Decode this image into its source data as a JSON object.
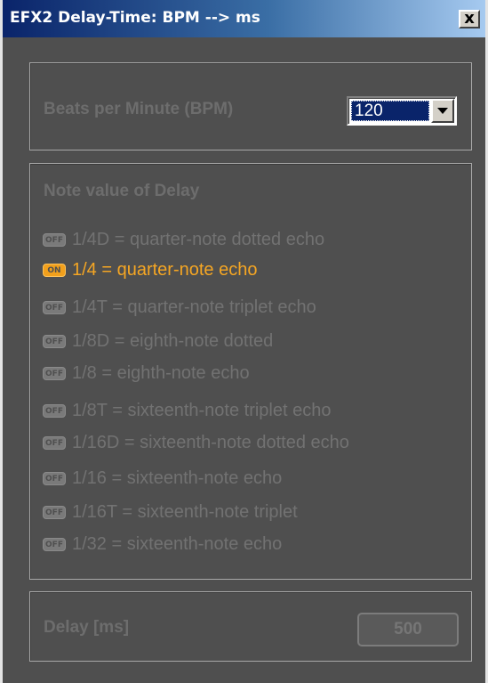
{
  "window": {
    "title": "EFX2 Delay-Time: BPM --> ms",
    "close_label": "x"
  },
  "bpm": {
    "label": "Beats per Minute (BPM)",
    "selected_value": "120"
  },
  "notes": {
    "title": "Note value of Delay",
    "items": [
      {
        "state": "OFF",
        "label": "1/4D =  quarter-note dotted echo",
        "active": false
      },
      {
        "state": "ON",
        "label": "1/4 = quarter-note echo",
        "active": true
      },
      {
        "state": "OFF",
        "label": "1/4T = quarter-note triplet echo",
        "active": false
      },
      {
        "state": "OFF",
        "label": "1/8D = eighth-note dotted",
        "active": false
      },
      {
        "state": "OFF",
        "label": "1/8 = eighth-note echo",
        "active": false
      },
      {
        "state": "OFF",
        "label": "1/8T = sixteenth-note triplet echo",
        "active": false
      },
      {
        "state": "OFF",
        "label": "1/16D = sixteenth-note dotted echo",
        "active": false
      },
      {
        "state": "OFF",
        "label": "1/16 = sixteenth-note echo",
        "active": false
      },
      {
        "state": "OFF",
        "label": "1/16T = sixteenth-note triplet",
        "active": false
      },
      {
        "state": "OFF",
        "label": "1/32 = sixteenth-note echo",
        "active": false
      }
    ]
  },
  "delay": {
    "label": "Delay [ms]",
    "value": "500"
  },
  "colors": {
    "panel_bg": "#4f4f4f",
    "accent_on": "#f5a623",
    "dim_text": "#727272",
    "title_bar": "#0a246a"
  }
}
